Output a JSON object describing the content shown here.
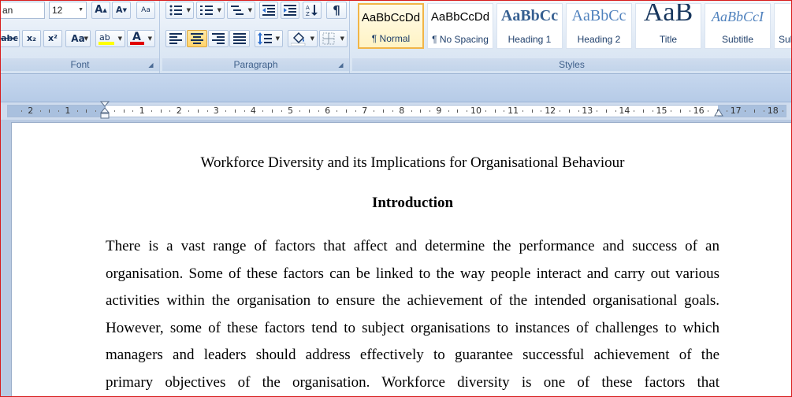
{
  "ribbon": {
    "font_group": {
      "label": "Font",
      "font_name": "an",
      "font_size": "12",
      "grow_label": "A",
      "shrink_label": "A",
      "clear_label": "Aa",
      "strike_label": "abc",
      "subscript_label": "x₂",
      "superscript_label": "x²",
      "change_case_label": "Aa",
      "highlight_label": "ab",
      "font_color_label": "A",
      "highlight_color": "#ffff00",
      "font_color": "#e00000"
    },
    "paragraph_group": {
      "label": "Paragraph",
      "pilcrow_label": "¶",
      "active_alignment": "center"
    },
    "styles_group": {
      "label": "Styles",
      "tiles": [
        {
          "preview": "AaBbCcDd",
          "name": "¶ Normal"
        },
        {
          "preview": "AaBbCcDd",
          "name": "¶ No Spacing"
        },
        {
          "preview": "AaBbCc",
          "name": "Heading 1"
        },
        {
          "preview": "AaBbCc",
          "name": "Heading 2"
        },
        {
          "preview": "AaB",
          "name": "Title"
        },
        {
          "preview": "AaBbCcI",
          "name": "Subtitle"
        },
        {
          "preview": "",
          "name": "Sub"
        }
      ]
    }
  },
  "ruler": {
    "labels": [
      "2",
      "1",
      "1",
      "2",
      "3",
      "4",
      "5",
      "6",
      "7",
      "8",
      "9",
      "10",
      "11",
      "12",
      "13",
      "14",
      "15",
      "16",
      "17",
      "18"
    ]
  },
  "document": {
    "title": "Workforce Diversity and its Implications for Organisational Behaviour",
    "heading": "Introduction",
    "body_lines": [
      "There is a vast range of factors that affect and determine the performance and success of an",
      "organisation. Some of these factors can be linked to the way people interact and carry out various",
      "activities within the organisation to ensure the achievement of the intended organisational goals.",
      "However, some of these factors tend to subject organisations to instances of challenges to which",
      "managers and leaders should address effectively to guarantee successful achievement of the",
      "primary objectives of the organisation. Workforce diversity is one of these factors that"
    ]
  }
}
